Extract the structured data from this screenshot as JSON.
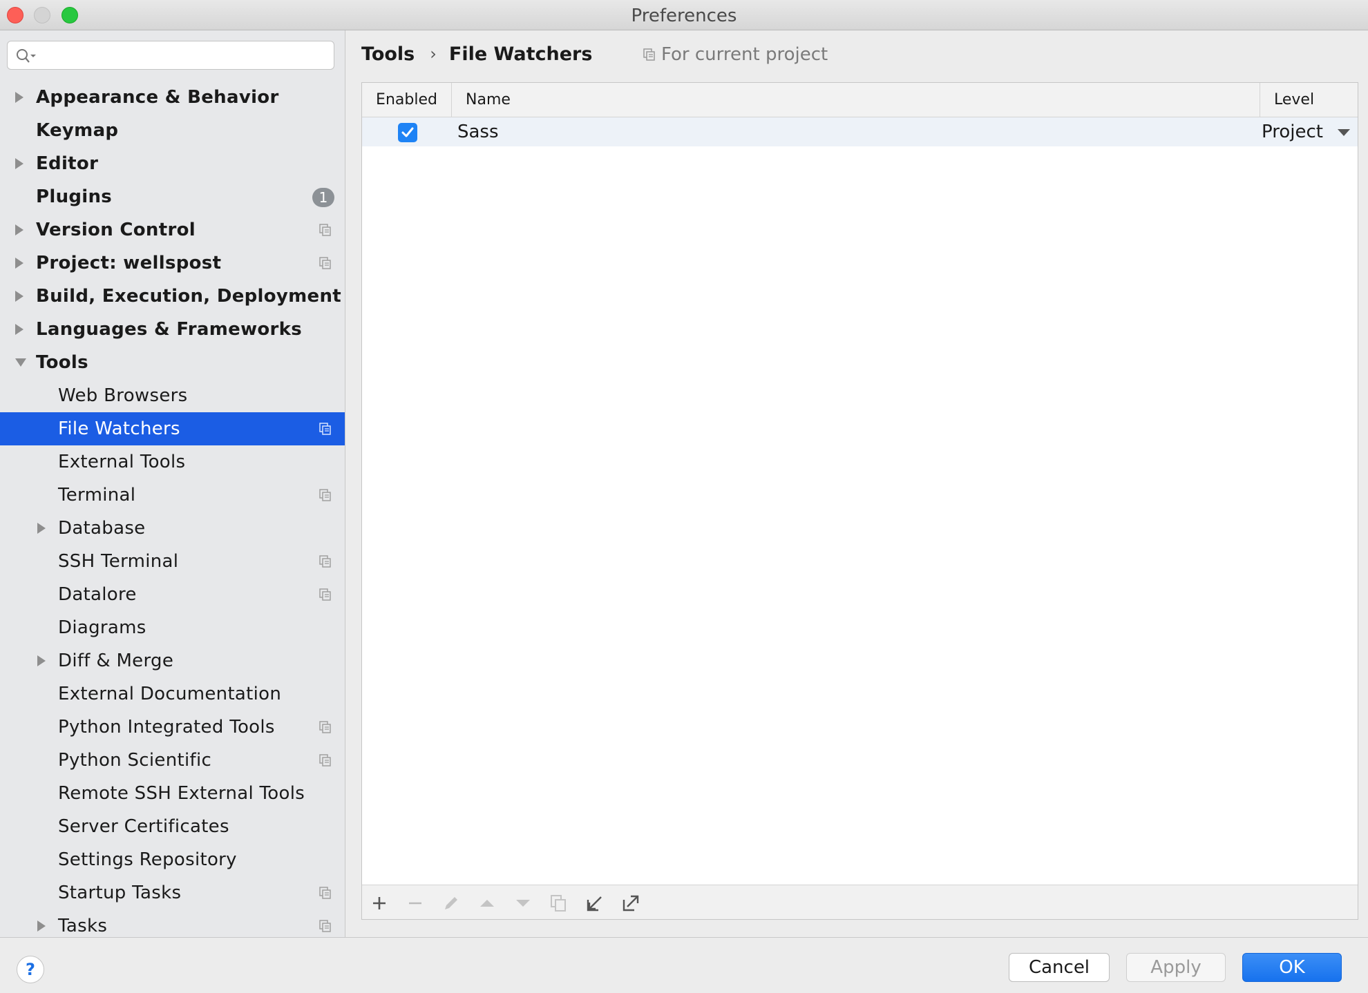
{
  "window": {
    "title": "Preferences"
  },
  "search": {
    "placeholder": ""
  },
  "sidebar": {
    "items": [
      {
        "label": "Appearance & Behavior",
        "level": 1,
        "bold": true,
        "arrow": "right"
      },
      {
        "label": "Keymap",
        "level": 1,
        "bold": true
      },
      {
        "label": "Editor",
        "level": 1,
        "bold": true,
        "arrow": "right"
      },
      {
        "label": "Plugins",
        "level": 1,
        "bold": true,
        "badge": "1"
      },
      {
        "label": "Version Control",
        "level": 1,
        "bold": true,
        "arrow": "right",
        "projectIcon": true
      },
      {
        "label": "Project: wellspost",
        "level": 1,
        "bold": true,
        "arrow": "right",
        "projectIcon": true
      },
      {
        "label": "Build, Execution, Deployment",
        "level": 1,
        "bold": true,
        "arrow": "right"
      },
      {
        "label": "Languages & Frameworks",
        "level": 1,
        "bold": true,
        "arrow": "right"
      },
      {
        "label": "Tools",
        "level": 1,
        "bold": true,
        "arrow": "down"
      },
      {
        "label": "Web Browsers",
        "level": 2
      },
      {
        "label": "File Watchers",
        "level": 2,
        "selected": true,
        "projectIcon": true
      },
      {
        "label": "External Tools",
        "level": 2
      },
      {
        "label": "Terminal",
        "level": 2,
        "projectIcon": true
      },
      {
        "label": "Database",
        "level": 2,
        "arrow": "right"
      },
      {
        "label": "SSH Terminal",
        "level": 2,
        "projectIcon": true
      },
      {
        "label": "Datalore",
        "level": 2,
        "projectIcon": true
      },
      {
        "label": "Diagrams",
        "level": 2
      },
      {
        "label": "Diff & Merge",
        "level": 2,
        "arrow": "right"
      },
      {
        "label": "External Documentation",
        "level": 2
      },
      {
        "label": "Python Integrated Tools",
        "level": 2,
        "projectIcon": true
      },
      {
        "label": "Python Scientific",
        "level": 2,
        "projectIcon": true
      },
      {
        "label": "Remote SSH External Tools",
        "level": 2
      },
      {
        "label": "Server Certificates",
        "level": 2
      },
      {
        "label": "Settings Repository",
        "level": 2
      },
      {
        "label": "Startup Tasks",
        "level": 2,
        "projectIcon": true
      },
      {
        "label": "Tasks",
        "level": 2,
        "arrow": "right",
        "projectIcon": true
      }
    ]
  },
  "breadcrumb": {
    "parent": "Tools",
    "separator": "›",
    "current": "File Watchers"
  },
  "scope": {
    "label": "For current project"
  },
  "table": {
    "headers": {
      "enabled": "Enabled",
      "name": "Name",
      "level": "Level"
    },
    "rows": [
      {
        "enabled": true,
        "name": "Sass",
        "level": "Project"
      }
    ]
  },
  "toolbar": {
    "icons": [
      "add-icon",
      "remove-icon",
      "edit-icon",
      "move-up-icon",
      "move-down-icon",
      "copy-icon",
      "import-icon",
      "export-icon"
    ]
  },
  "buttons": {
    "help": "?",
    "cancel": "Cancel",
    "apply": "Apply",
    "ok": "OK"
  },
  "colors": {
    "accent": "#1b5de4",
    "checkbox": "#1e83f5",
    "ok": "#1772ee"
  }
}
